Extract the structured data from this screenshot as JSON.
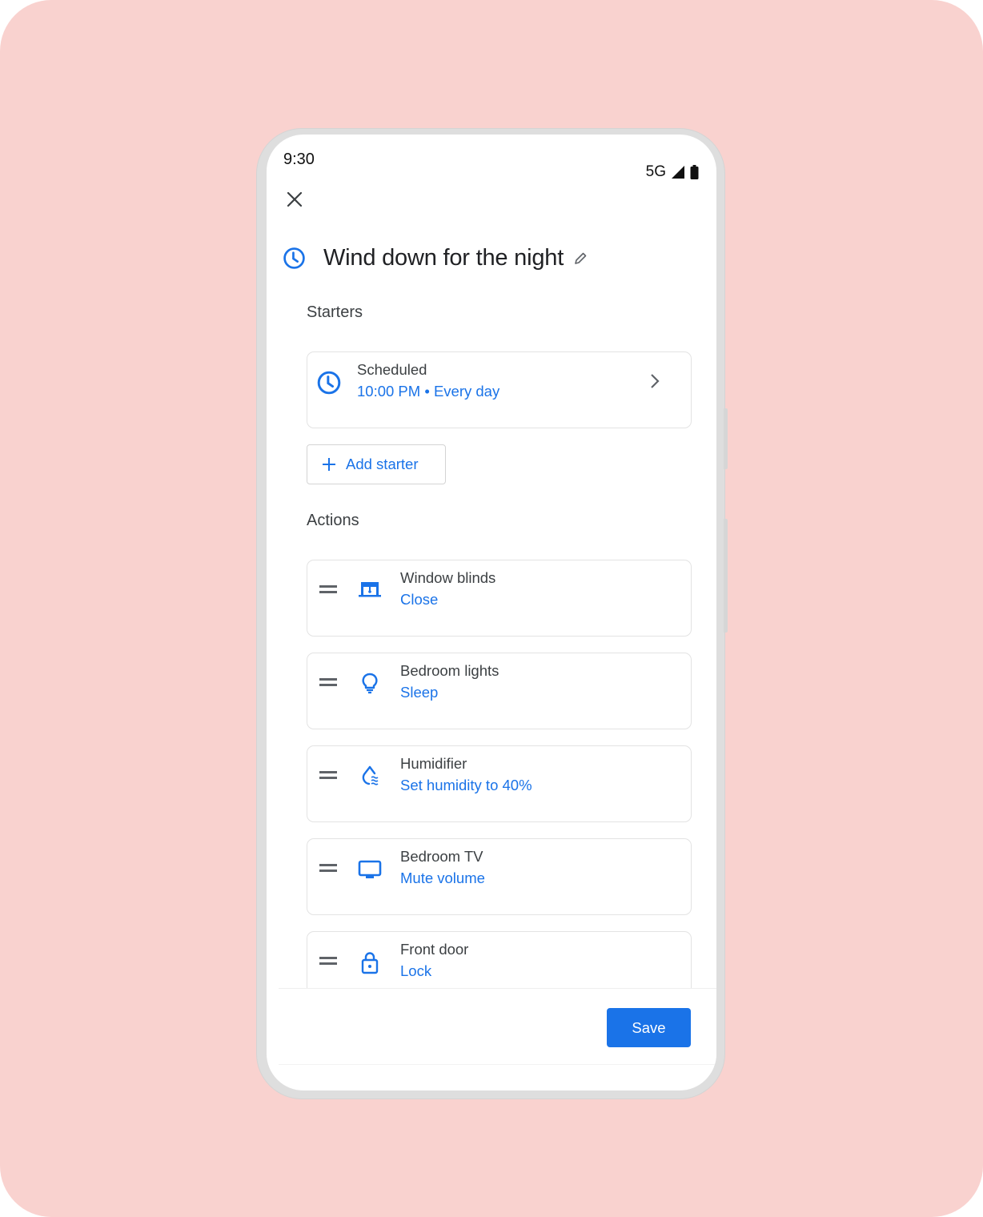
{
  "status_bar": {
    "time": "9:30",
    "network": "5G",
    "signal_icon": "signal-icon",
    "battery_icon": "battery-icon"
  },
  "header": {
    "close_icon": "close-icon",
    "title": "Wind down for the night",
    "title_icon": "clock-icon",
    "edit_icon": "pencil-icon"
  },
  "starters": {
    "label": "Starters",
    "items": [
      {
        "icon": "clock-icon",
        "title": "Scheduled",
        "detail": "10:00 PM • Every day",
        "chevron": "chevron-right-icon"
      }
    ],
    "add_button": {
      "icon": "plus-icon",
      "label": "Add starter"
    }
  },
  "actions": {
    "label": "Actions",
    "items": [
      {
        "icon": "window-blinds-icon",
        "device": "Window blinds",
        "action": "Close"
      },
      {
        "icon": "lightbulb-icon",
        "device": "Bedroom lights",
        "action": "Sleep"
      },
      {
        "icon": "humidity-icon",
        "device": "Humidifier",
        "action": "Set humidity to 40%"
      },
      {
        "icon": "tv-icon",
        "device": "Bedroom TV",
        "action": "Mute volume"
      },
      {
        "icon": "lock-icon",
        "device": "Front door",
        "action": "Lock"
      }
    ]
  },
  "footer": {
    "save_label": "Save"
  },
  "colors": {
    "accent": "#1a73e8",
    "background": "#f9d2cf",
    "text": "#3c4043"
  }
}
